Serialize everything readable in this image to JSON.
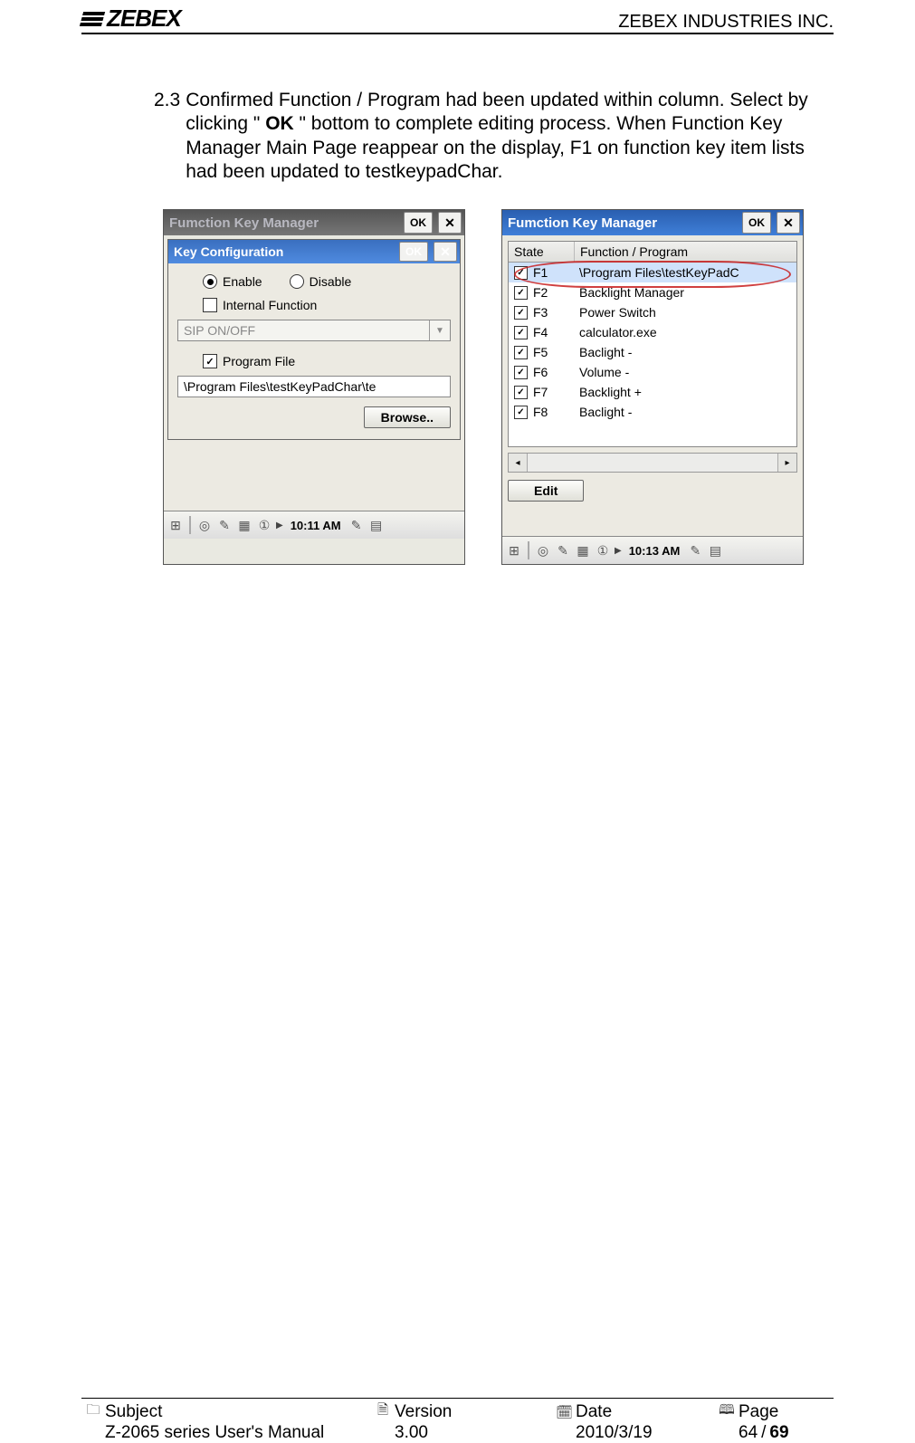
{
  "header": {
    "logo_text": "ZEBEX",
    "company": "ZEBEX INDUSTRIES INC."
  },
  "body": {
    "section_num": "2.3",
    "para_pre": "Confirmed Function / Program had been updated within column. Select by clicking \" ",
    "ok_word": "OK",
    "para_post": " \" bottom to complete editing process. When Function Key Manager Main Page reappear on the display, F1 on function key item lists had been updated to testkeypadChar."
  },
  "left": {
    "outer_title": "Fumction Key Manager",
    "ok_label": "OK",
    "x_label": "✕",
    "inner_title": "Key Configuration",
    "enable_label": "Enable",
    "disable_label": "Disable",
    "internal_label": "Internal Function",
    "combo_value": "SIP ON/OFF",
    "programfile_label": "Program File",
    "path_value": "\\Program Files\\testKeyPadChar\\te",
    "browse_label": "Browse..",
    "time": "10:11 AM"
  },
  "right": {
    "title": "Fumction Key Manager",
    "ok_label": "OK",
    "x_label": "✕",
    "col_state": "State",
    "col_func": "Function / Program",
    "rows": [
      {
        "key": "F1",
        "prog": "\\Program Files\\testKeyPadC"
      },
      {
        "key": "F2",
        "prog": "Backlight Manager"
      },
      {
        "key": "F3",
        "prog": "Power Switch"
      },
      {
        "key": "F4",
        "prog": "calculator.exe"
      },
      {
        "key": "F5",
        "prog": "Baclight -"
      },
      {
        "key": "F6",
        "prog": "Volume -"
      },
      {
        "key": "F7",
        "prog": "Backlight +"
      },
      {
        "key": "F8",
        "prog": "Baclight -"
      }
    ],
    "edit_label": "Edit",
    "time": "10:13 AM"
  },
  "footer": {
    "subject_label": "Subject",
    "subject_value": "Z-2065 series User's Manual",
    "version_label": "Version",
    "version_value": "3.00",
    "date_label": "Date",
    "date_value": "2010/3/19",
    "page_label": "Page",
    "page_current": "64",
    "page_sep": " / ",
    "page_total": "69"
  }
}
